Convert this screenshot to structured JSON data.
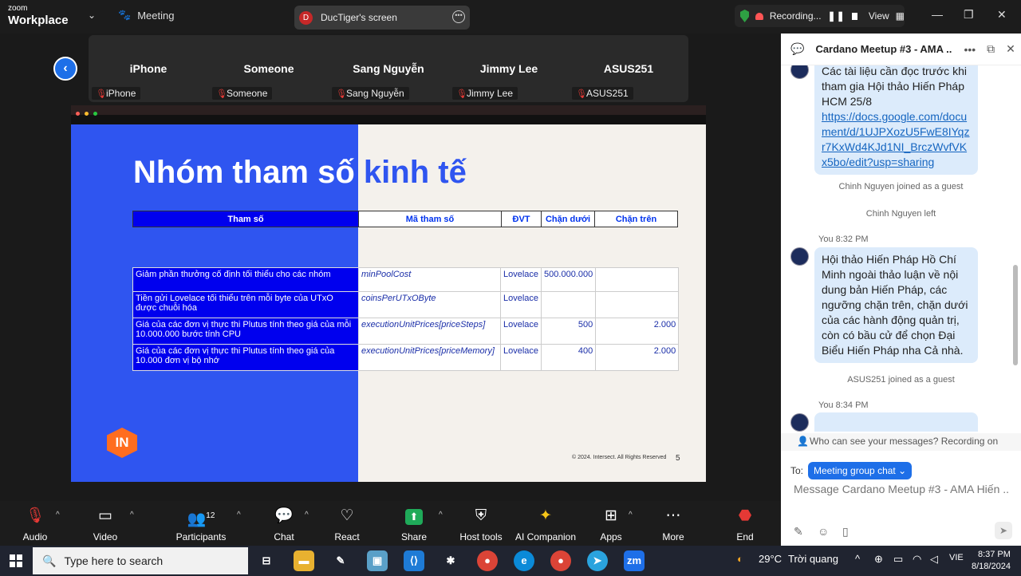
{
  "app": {
    "brand_top": "zoom",
    "brand_bottom": "Workplace",
    "meeting_label": "Meeting"
  },
  "screen_share": {
    "initial": "D",
    "label": "DucTiger's screen"
  },
  "recording": {
    "label": "Recording...",
    "view_label": "View"
  },
  "participants_strip": [
    {
      "name": "iPhone",
      "label": "iPhone"
    },
    {
      "name": "Someone",
      "label": "Someone"
    },
    {
      "name": "Sang Nguyễn",
      "label": "Sang Nguyễn"
    },
    {
      "name": "Jimmy Lee",
      "label": "Jimmy Lee"
    },
    {
      "name": "ASUS251",
      "label": "ASUS251"
    }
  ],
  "slide": {
    "title_part1": "Nhóm tham số",
    "title_part2": "kinh tế",
    "headers": [
      "Tham số",
      "Mã tham số",
      "ĐVT",
      "Chặn dưới",
      "Chặn trên"
    ],
    "rows": [
      {
        "param": "Giảm phần thưởng cố định tối thiểu cho các nhóm",
        "code": "minPoolCost",
        "unit": "Lovelace",
        "lower": "500.000.000",
        "upper": ""
      },
      {
        "param": "Tiền gửi Lovelace tối thiểu trên mỗi byte của UTxO được chuỗi hóa",
        "code": "coinsPerUTxOByte",
        "unit": "Lovelace",
        "lower": "",
        "upper": ""
      },
      {
        "param": "Giá của các đơn vị thực thi Plutus tính theo giá của mỗi 10.000.000 bước tính CPU",
        "code": "executionUnitPrices[priceSteps]",
        "unit": "Lovelace",
        "lower": "500",
        "upper": "2.000"
      },
      {
        "param": "Giá của các đơn vị thực thi Plutus tính theo giá của 10.000 đơn vị bộ nhớ",
        "code": "executionUnitPrices[priceMemory]",
        "unit": "Lovelace",
        "lower": "400",
        "upper": "2.000"
      }
    ],
    "logo_text": "IN",
    "copyright": "© 2024. Intersect. All Rights Reserved",
    "page_number": "5"
  },
  "chat": {
    "title": "Cardano Meetup #3 - AMA ...",
    "message1_text": "Các tài liệu cần đọc trước khi tham gia Hội thảo Hiến Pháp HCM 25/8",
    "message1_link": "https://docs.google.com/document/d/1UJPXozU5FwE8IYqzr7KxWd4KJd1NI_BrczWvfVKx5bo/edit?usp=sharing",
    "system1": "Chinh Nguyen joined as a guest",
    "system2": "Chinh Nguyen left",
    "meta2": "You 8:32 PM",
    "message2_text": "Hội thảo Hiến Pháp Hồ Chí Minh ngoài thảo luận về nội dung bản Hiến Pháp, các ngưỡng chặn trên, chặn dưới của các hành động quản trị, còn có bầu cử để chọn Đại Biểu Hiến Pháp nha Cả nhà.",
    "system3": "ASUS251 joined as a guest",
    "meta3": "You 8:34 PM",
    "privacy": "Who can see your messages? Recording on",
    "to_label": "To:",
    "to_value": "Meeting group chat",
    "input_placeholder": "Message Cardano Meetup #3 - AMA Hiến ..."
  },
  "controls": {
    "audio": "Audio",
    "video": "Video",
    "participants": "Participants",
    "participants_count": "12",
    "chat": "Chat",
    "react": "React",
    "share": "Share",
    "host_tools": "Host tools",
    "ai": "AI Companion",
    "apps": "Apps",
    "more": "More",
    "end": "End"
  },
  "taskbar": {
    "search_placeholder": "Type here to search",
    "weather_temp": "29°C",
    "weather_text": "Trời quang",
    "language": "VIE",
    "time": "8:37 PM",
    "date": "8/18/2024",
    "zoom_label": "zm"
  }
}
